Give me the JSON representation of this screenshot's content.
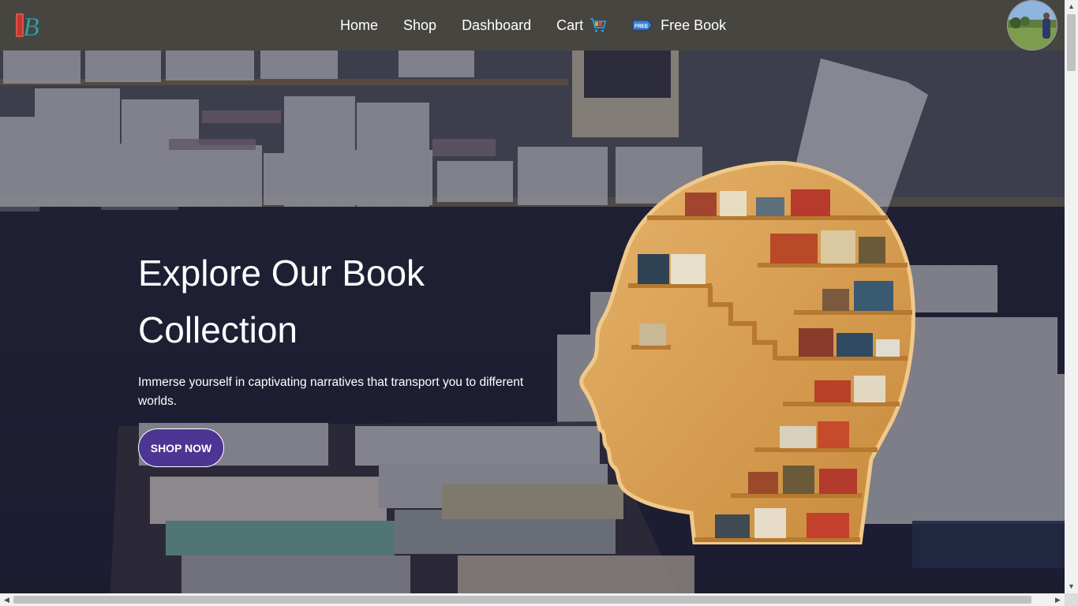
{
  "nav": {
    "logo_letter": "B",
    "links": [
      {
        "label": "Home"
      },
      {
        "label": "Shop"
      },
      {
        "label": "Dashboard"
      },
      {
        "label": "Cart",
        "icon": "shopping-cart-icon"
      },
      {
        "label": "Free Book",
        "icon": "free-tag-icon",
        "icon_text": "FREE"
      }
    ]
  },
  "hero": {
    "title": "Explore Our Book Collection",
    "subtitle": "Immerse yourself in captivating narratives that transport you to different worlds.",
    "cta_label": "SHOP NOW"
  },
  "colors": {
    "navbar": "#47453f",
    "button": "#4c3593",
    "hero_text": "#ffffff",
    "shelf_wood": "#d9a25a"
  }
}
